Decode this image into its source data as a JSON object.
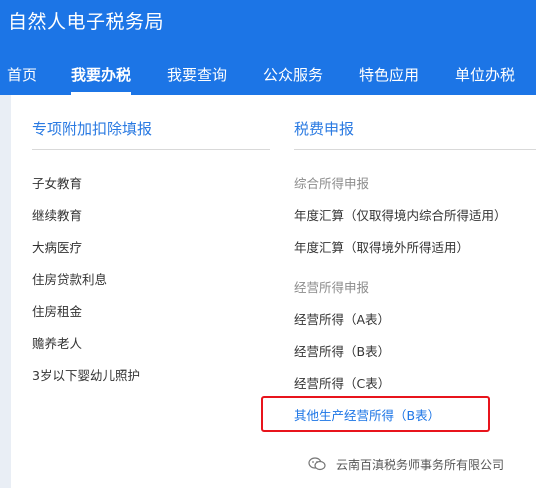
{
  "app": {
    "title": "自然人电子税务局"
  },
  "nav": [
    {
      "label": "首页",
      "active": false
    },
    {
      "label": "我要办税",
      "active": true
    },
    {
      "label": "我要查询",
      "active": false
    },
    {
      "label": "公众服务",
      "active": false
    },
    {
      "label": "特色应用",
      "active": false
    },
    {
      "label": "单位办税",
      "active": false
    }
  ],
  "left_section": {
    "title": "专项附加扣除填报",
    "items": [
      "子女教育",
      "继续教育",
      "大病医疗",
      "住房贷款利息",
      "住房租金",
      "赡养老人",
      "3岁以下婴幼儿照护"
    ]
  },
  "right_section": {
    "title": "税费申报",
    "groups": [
      {
        "heading": "综合所得申报",
        "items": [
          "年度汇算（仅取得境内综合所得适用）",
          "年度汇算（取得境外所得适用）"
        ]
      },
      {
        "heading": "经营所得申报",
        "items": [
          "经营所得（A表）",
          "经营所得（B表）",
          "经营所得（C表）",
          "其他生产经营所得（B表）"
        ]
      }
    ]
  },
  "watermark": {
    "text": "云南百滇税务师事务所有限公司",
    "icon": "wechat-icon"
  },
  "colors": {
    "header_bg": "#1c75e6",
    "link_blue": "#2a7ae2",
    "highlight_border": "#e8141c"
  }
}
